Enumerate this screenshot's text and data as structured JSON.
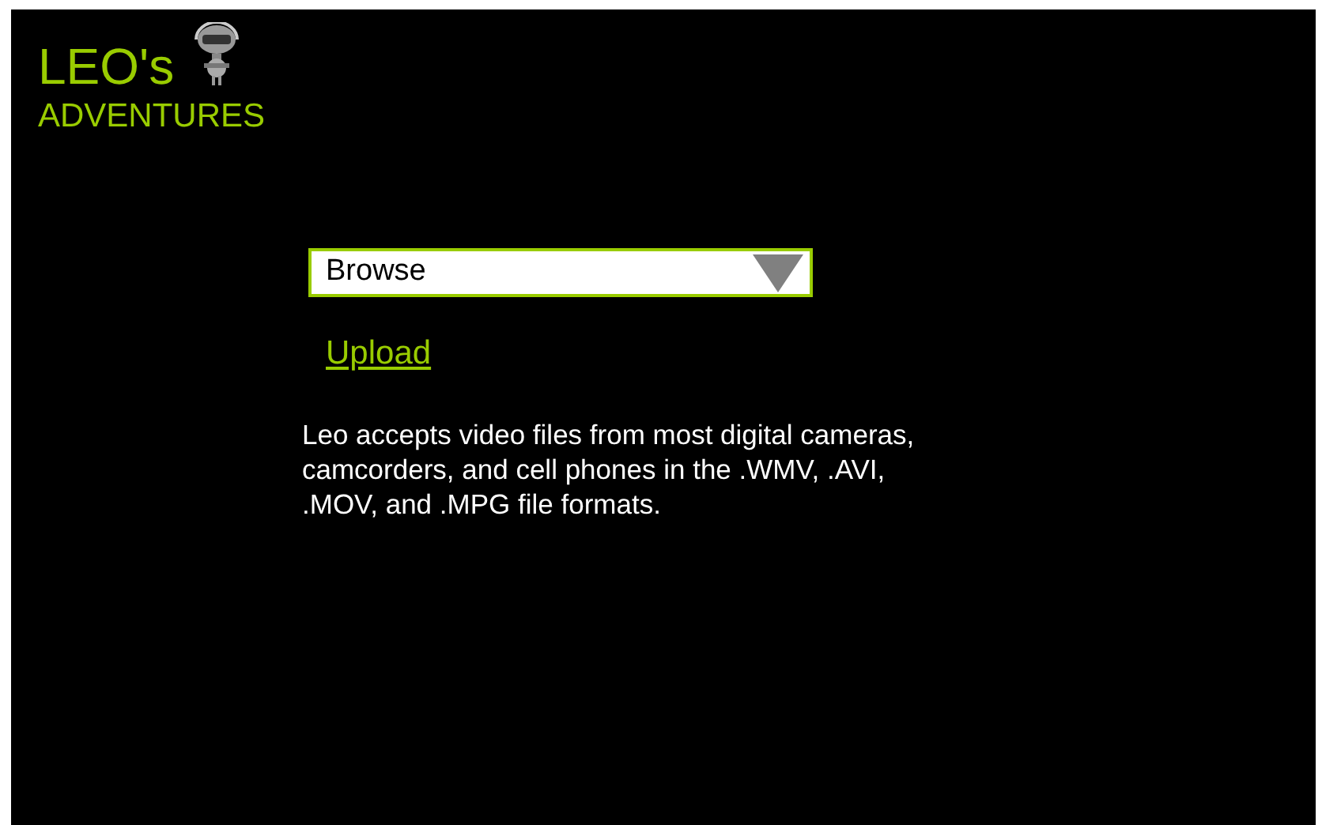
{
  "logo": {
    "title": "LEO's",
    "subtitle": "ADVENTURES"
  },
  "dropdown": {
    "value": "Browse"
  },
  "upload_link": "Upload",
  "description": "Leo accepts video files from most digital cameras, camcorders, and cell phones in the .WMV, .AVI,  .MOV, and .MPG file formats."
}
